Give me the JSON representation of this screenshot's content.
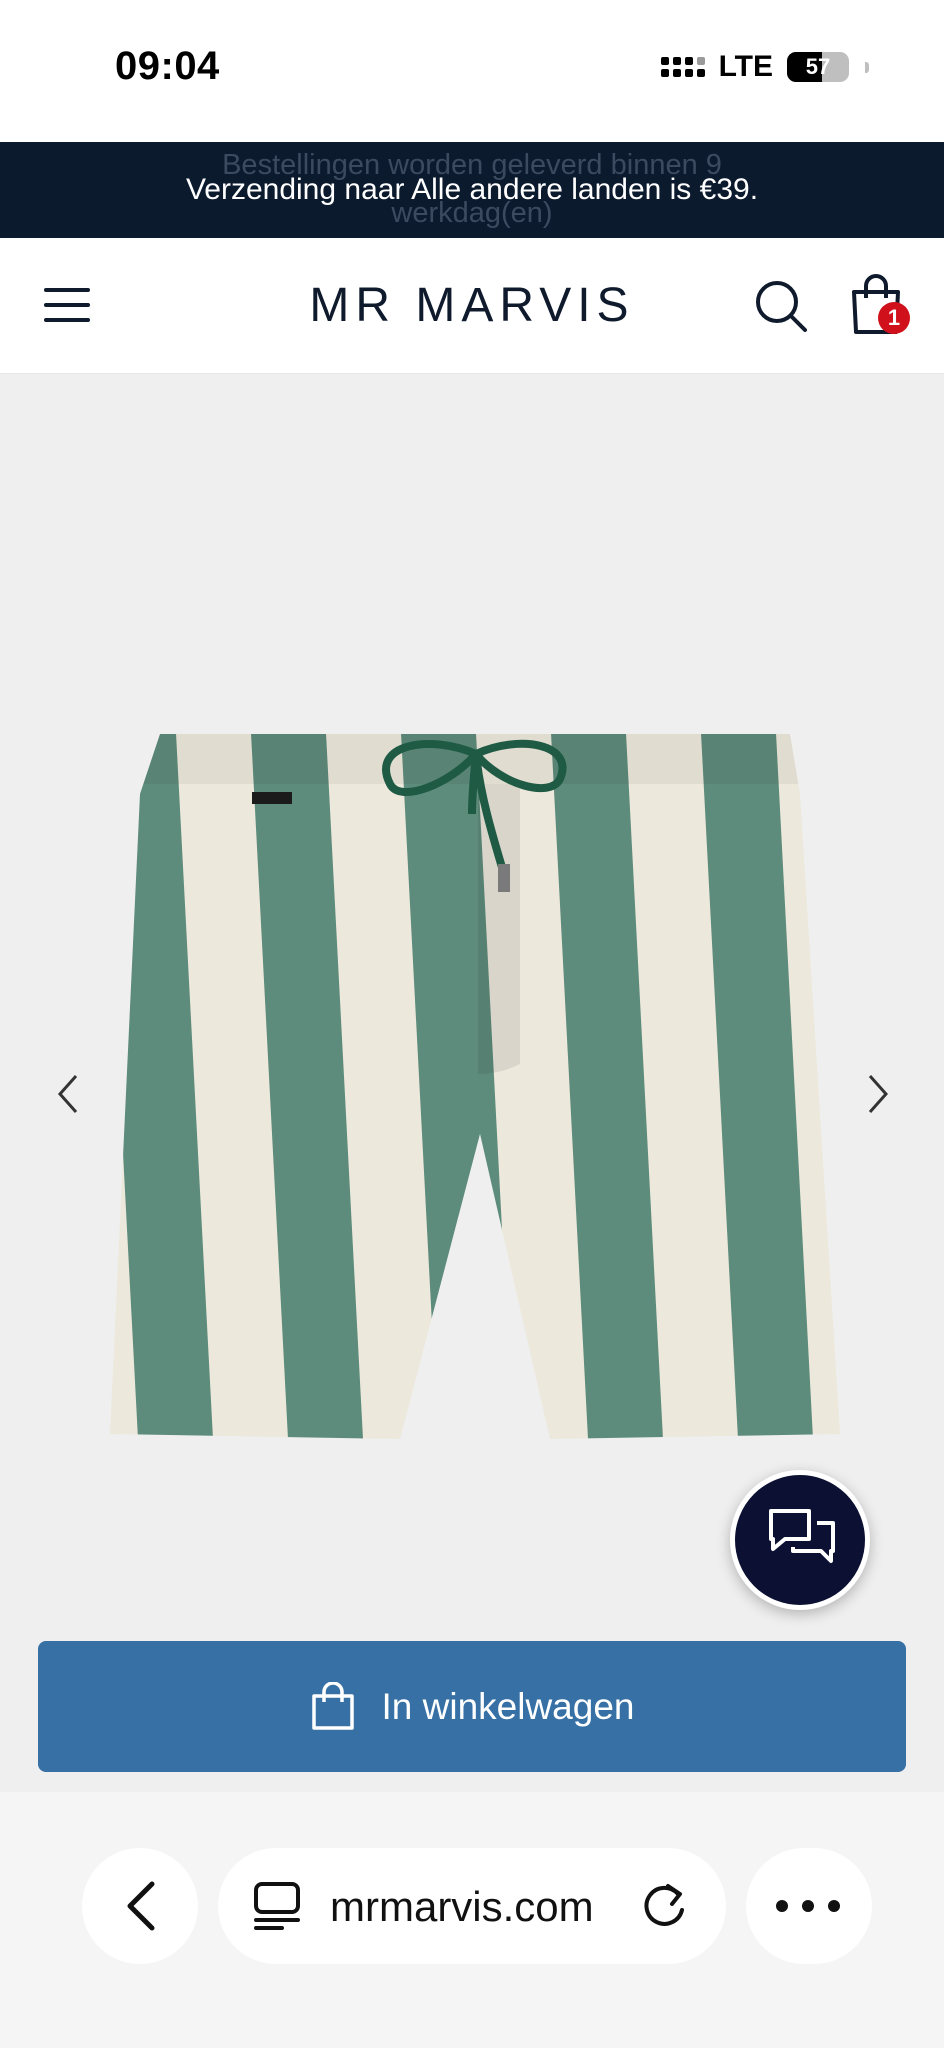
{
  "status_bar": {
    "time": "09:04",
    "network": "LTE",
    "battery": "57"
  },
  "announcement": {
    "ghost_line_1": "Bestellingen worden geleverd binnen 9",
    "main": "Verzending naar Alle andere landen is €39.",
    "ghost_line_2": "werkdag(en)"
  },
  "header": {
    "logo": "MR MARVIS",
    "cart_count": "1"
  },
  "product": {
    "colors": {
      "stripe_green": "#5e8c7c",
      "stripe_cream": "#ece8dc",
      "drawstring": "#1f5a45"
    }
  },
  "cart_button": {
    "label": "In winkelwagen"
  },
  "browser": {
    "url": "mrmarvis.com"
  },
  "colors": {
    "navy": "#0c1a2e",
    "button_blue": "#3670a4",
    "badge_red": "#d0111b",
    "gallery_bg": "#efefef"
  }
}
